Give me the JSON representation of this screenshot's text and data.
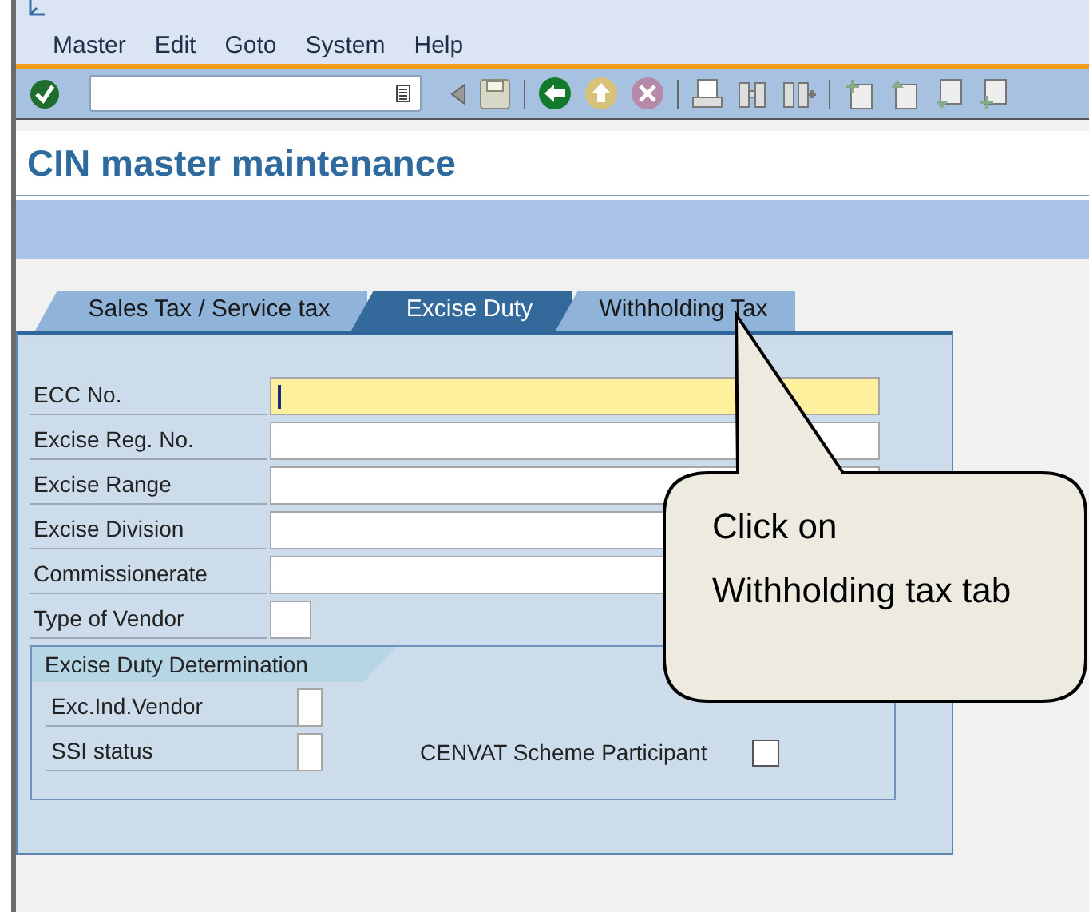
{
  "window": {
    "menu": [
      {
        "label": "Master"
      },
      {
        "label": "Edit"
      },
      {
        "label": "Goto"
      },
      {
        "label": "System"
      },
      {
        "label": "Help"
      }
    ],
    "title": "CIN master maintenance"
  },
  "tabs": [
    {
      "label": "Sales Tax / Service tax",
      "selected": false
    },
    {
      "label": "Excise Duty",
      "selected": true
    },
    {
      "label": "Withholding Tax",
      "selected": false
    }
  ],
  "fields": [
    {
      "label": "ECC No.",
      "kind": "long",
      "focused": true
    },
    {
      "label": "Excise Reg. No.",
      "kind": "long",
      "focused": false
    },
    {
      "label": "Excise Range",
      "kind": "long",
      "focused": false
    },
    {
      "label": "Excise Division",
      "kind": "long",
      "focused": false
    },
    {
      "label": "Commissionerate",
      "kind": "long",
      "focused": false
    },
    {
      "label": "Type of Vendor",
      "kind": "short",
      "focused": false
    }
  ],
  "group": {
    "title": "Excise Duty Determination",
    "fields": [
      {
        "label": "Exc.Ind.Vendor"
      },
      {
        "label": "SSI status"
      }
    ],
    "checkbox": {
      "label": "CENVAT Scheme Participant",
      "checked": false
    }
  },
  "callout": {
    "text": "Click on Withholding tax tab"
  }
}
